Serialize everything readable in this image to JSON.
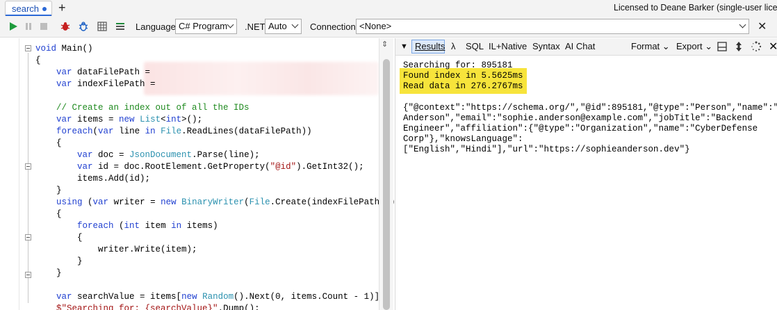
{
  "tabs": {
    "active_label": "search",
    "new_tab_symbol": "+"
  },
  "license_text": "Licensed to Deane Barker (single-user license",
  "toolbar": {
    "language_label": "Language",
    "language_value": "C# Program",
    "dotnet_label": ".NET",
    "dotnet_value": "Auto",
    "connection_label": "Connection",
    "connection_value": "<None>",
    "close_symbol": "✕"
  },
  "icons": {
    "run": "run-icon",
    "pause": "pause-icon",
    "stop": "stop-icon",
    "bug": "bug-icon",
    "bug_alt": "bug-outline-icon",
    "grid": "grid-icon",
    "list": "list-icon"
  },
  "code": [
    {
      "tokens": [
        {
          "t": "kw",
          "v": "void"
        },
        {
          "t": "",
          "v": " Main()"
        }
      ]
    },
    {
      "tokens": [
        {
          "t": "",
          "v": "{"
        }
      ]
    },
    {
      "tokens": [
        {
          "t": "",
          "v": "    "
        },
        {
          "t": "kw",
          "v": "var"
        },
        {
          "t": "",
          "v": " dataFilePath ="
        }
      ]
    },
    {
      "tokens": [
        {
          "t": "",
          "v": "    "
        },
        {
          "t": "kw",
          "v": "var"
        },
        {
          "t": "",
          "v": " indexFilePath ="
        }
      ]
    },
    {
      "tokens": [
        {
          "t": "",
          "v": ""
        }
      ]
    },
    {
      "tokens": [
        {
          "t": "",
          "v": "    "
        },
        {
          "t": "cm",
          "v": "// Create an index out of all the IDs"
        }
      ]
    },
    {
      "tokens": [
        {
          "t": "",
          "v": "    "
        },
        {
          "t": "kw",
          "v": "var"
        },
        {
          "t": "",
          "v": " items = "
        },
        {
          "t": "kw",
          "v": "new"
        },
        {
          "t": "",
          "v": " "
        },
        {
          "t": "ty",
          "v": "List"
        },
        {
          "t": "",
          "v": "<"
        },
        {
          "t": "kw",
          "v": "int"
        },
        {
          "t": "",
          "v": ">();"
        }
      ]
    },
    {
      "tokens": [
        {
          "t": "",
          "v": "    "
        },
        {
          "t": "kw",
          "v": "foreach"
        },
        {
          "t": "",
          "v": "("
        },
        {
          "t": "kw",
          "v": "var"
        },
        {
          "t": "",
          "v": " line "
        },
        {
          "t": "kw",
          "v": "in"
        },
        {
          "t": "",
          "v": " "
        },
        {
          "t": "ty",
          "v": "File"
        },
        {
          "t": "",
          "v": ".ReadLines(dataFilePath))"
        }
      ]
    },
    {
      "tokens": [
        {
          "t": "",
          "v": "    {"
        }
      ]
    },
    {
      "tokens": [
        {
          "t": "",
          "v": "        "
        },
        {
          "t": "kw",
          "v": "var"
        },
        {
          "t": "",
          "v": " doc = "
        },
        {
          "t": "ty",
          "v": "JsonDocument"
        },
        {
          "t": "",
          "v": ".Parse(line);"
        }
      ]
    },
    {
      "tokens": [
        {
          "t": "",
          "v": "        "
        },
        {
          "t": "kw",
          "v": "var"
        },
        {
          "t": "",
          "v": " id = doc.RootElement.GetProperty("
        },
        {
          "t": "st",
          "v": "\"@id\""
        },
        {
          "t": "",
          "v": ").GetInt32();"
        }
      ]
    },
    {
      "tokens": [
        {
          "t": "",
          "v": "        items.Add(id);"
        }
      ]
    },
    {
      "tokens": [
        {
          "t": "",
          "v": "    }"
        }
      ]
    },
    {
      "tokens": [
        {
          "t": "",
          "v": "    "
        },
        {
          "t": "kw",
          "v": "using"
        },
        {
          "t": "",
          "v": " ("
        },
        {
          "t": "kw",
          "v": "var"
        },
        {
          "t": "",
          "v": " writer = "
        },
        {
          "t": "kw",
          "v": "new"
        },
        {
          "t": "",
          "v": " "
        },
        {
          "t": "ty",
          "v": "BinaryWriter"
        },
        {
          "t": "",
          "v": "("
        },
        {
          "t": "ty",
          "v": "File"
        },
        {
          "t": "",
          "v": ".Create(indexFilePath)))"
        }
      ]
    },
    {
      "tokens": [
        {
          "t": "",
          "v": "    {"
        }
      ]
    },
    {
      "tokens": [
        {
          "t": "",
          "v": "        "
        },
        {
          "t": "kw",
          "v": "foreach"
        },
        {
          "t": "",
          "v": " ("
        },
        {
          "t": "kw",
          "v": "int"
        },
        {
          "t": "",
          "v": " item "
        },
        {
          "t": "kw",
          "v": "in"
        },
        {
          "t": "",
          "v": " items)"
        }
      ]
    },
    {
      "tokens": [
        {
          "t": "",
          "v": "        {"
        }
      ]
    },
    {
      "tokens": [
        {
          "t": "",
          "v": "            writer.Write(item);"
        }
      ]
    },
    {
      "tokens": [
        {
          "t": "",
          "v": "        }"
        }
      ]
    },
    {
      "tokens": [
        {
          "t": "",
          "v": "    }"
        }
      ]
    },
    {
      "tokens": [
        {
          "t": "",
          "v": ""
        }
      ]
    },
    {
      "tokens": [
        {
          "t": "",
          "v": "    "
        },
        {
          "t": "kw",
          "v": "var"
        },
        {
          "t": "",
          "v": " searchValue = items["
        },
        {
          "t": "kw",
          "v": "new"
        },
        {
          "t": "",
          "v": " "
        },
        {
          "t": "ty",
          "v": "Random"
        },
        {
          "t": "",
          "v": "().Next(0, items.Count - 1)];"
        }
      ]
    },
    {
      "tokens": [
        {
          "t": "",
          "v": "    "
        },
        {
          "t": "st",
          "v": "$\"Searching for: {searchValue}\""
        },
        {
          "t": "",
          "v": ".Dump();"
        }
      ]
    }
  ],
  "results_toolbar": {
    "collapse_symbol": "▼",
    "results_label": "Results",
    "lambda_label": "λ",
    "sql_label": "SQL",
    "il_label": "IL+Native",
    "syntax_label": "Syntax",
    "ai_label": "AI Chat",
    "format_label": "Format",
    "export_label": "Export"
  },
  "output": {
    "searching": "Searching for: 895181",
    "found": "Found index in 5.5625ms",
    "read": "Read data in 276.2767ms",
    "json_lines": [
      "{\"@context\":\"https://schema.org/\",\"@id\":895181,\"@type\":\"Person\",\"name\":\"So",
      "Anderson\",\"email\":\"sophie.anderson@example.com\",\"jobTitle\":\"Backend",
      "Engineer\",\"affiliation\":{\"@type\":\"Organization\",\"name\":\"CyberDefense",
      "Corp\"},\"knowsLanguage\":",
      "[\"English\",\"Hindi\"],\"url\":\"https://sophieanderson.dev\"}"
    ]
  },
  "colors": {
    "accent": "#2b68d6",
    "highlight": "#f7e43b",
    "keyword": "#1f3fd0",
    "type": "#2b91af",
    "comment": "#1f8a1f",
    "string": "#a31515"
  }
}
